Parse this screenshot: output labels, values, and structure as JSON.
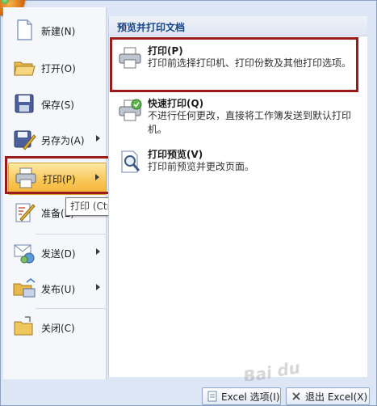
{
  "left_menu": {
    "items": [
      {
        "label": "新建(N)",
        "icon": "new-document-icon"
      },
      {
        "label": "打开(O)",
        "icon": "open-folder-icon"
      },
      {
        "label": "保存(S)",
        "icon": "save-disk-icon"
      },
      {
        "label": "另存为(A)",
        "icon": "save-as-icon"
      },
      {
        "label": "打印(P)",
        "icon": "printer-icon"
      },
      {
        "label": "准备(E)",
        "icon": "prepare-icon"
      },
      {
        "label": "发送(D)",
        "icon": "send-icon"
      },
      {
        "label": "发布(U)",
        "icon": "publish-icon"
      },
      {
        "label": "关闭(C)",
        "icon": "close-folder-icon"
      }
    ]
  },
  "tooltip": {
    "text": "打印 (Ctrl+P)"
  },
  "right_panel": {
    "header": "预览并打印文档",
    "options": [
      {
        "title": "打印(P)",
        "desc": "打印前选择打印机、打印份数及其他打印选项。",
        "icon": "printer-icon"
      },
      {
        "title": "快速打印(Q)",
        "desc": "不进行任何更改，直接将工作簿发送到默认打印机。",
        "icon": "quick-print-icon"
      },
      {
        "title": "打印预览(V)",
        "desc": "打印前预览并更改页面。",
        "icon": "print-preview-icon"
      }
    ]
  },
  "bottom_bar": {
    "options_button": "Excel 选项(I)",
    "exit_button": "退出 Excel(X)"
  },
  "colors": {
    "accent_highlight": "#9b1b1b",
    "active_item": "#f9c758",
    "header_text": "#15428b"
  }
}
